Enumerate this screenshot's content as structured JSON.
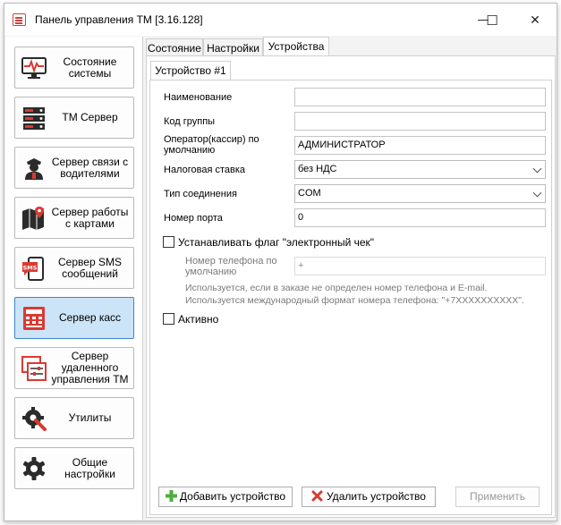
{
  "window": {
    "title": "Панель управления ТМ [3.16.128]",
    "minimize_glyph": "—",
    "maximize_glyph": "☐",
    "close_glyph": "✕"
  },
  "sidebar": {
    "items": [
      {
        "label": "Состояние системы",
        "icon": "monitor-pulse-icon",
        "active": false
      },
      {
        "label": "ТМ Сервер",
        "icon": "server-icon",
        "active": false
      },
      {
        "label": "Сервер связи с водителями",
        "icon": "driver-icon",
        "active": false
      },
      {
        "label": "Сервер работы с картами",
        "icon": "map-icon",
        "active": false
      },
      {
        "label": "Сервер SMS сообщений",
        "icon": "sms-icon",
        "active": false
      },
      {
        "label": "Сервер касс",
        "icon": "cash-register-icon",
        "active": true
      },
      {
        "label": "Сервер удаленного управления ТМ",
        "icon": "remote-control-icon",
        "active": false
      },
      {
        "label": "Утилиты",
        "icon": "tools-icon",
        "active": false
      },
      {
        "label": "Общие настройки",
        "icon": "gear-icon",
        "active": false
      }
    ]
  },
  "tabs": [
    {
      "label": "Состояние",
      "active": false
    },
    {
      "label": "Настройки",
      "active": false
    },
    {
      "label": "Устройства",
      "active": true
    }
  ],
  "device_tab": {
    "label": "Устройство #1"
  },
  "form": {
    "name_label": "Наименование",
    "name_value": "",
    "group_code_label": "Код группы",
    "group_code_value": "",
    "operator_label_line1": "Оператор(кассир) по",
    "operator_label_line2": "умолчанию",
    "operator_value": "АДМИНИСТРАТОР",
    "tax_label": "Налоговая ставка",
    "tax_value": "без НДС",
    "connection_label": "Тип соединения",
    "connection_value": "COM",
    "port_label": "Номер порта",
    "port_value": "0",
    "echeck_label": "Устанавливать флаг \"электронный чек\"",
    "echeck_checked": false,
    "phone_label_line1": "Номер телефона по",
    "phone_label_line2": "умолчанию",
    "phone_value": "+",
    "phone_hint_line1": "Используется, если в заказе не определен номер телефона и E-mail.",
    "phone_hint_line2": "Используется международный формат номера телефона: \"+7XXXXXXXXXX\".",
    "active_label": "Активно",
    "active_checked": false
  },
  "footer": {
    "add_label": "Добавить устройство",
    "delete_label": "Удалить устройство",
    "apply_label": "Применить"
  },
  "colors": {
    "accent": "#3e86c8",
    "icon_red": "#d93a32",
    "icon_dark": "#2b2b2b",
    "active_bg": "#cce4f7"
  }
}
